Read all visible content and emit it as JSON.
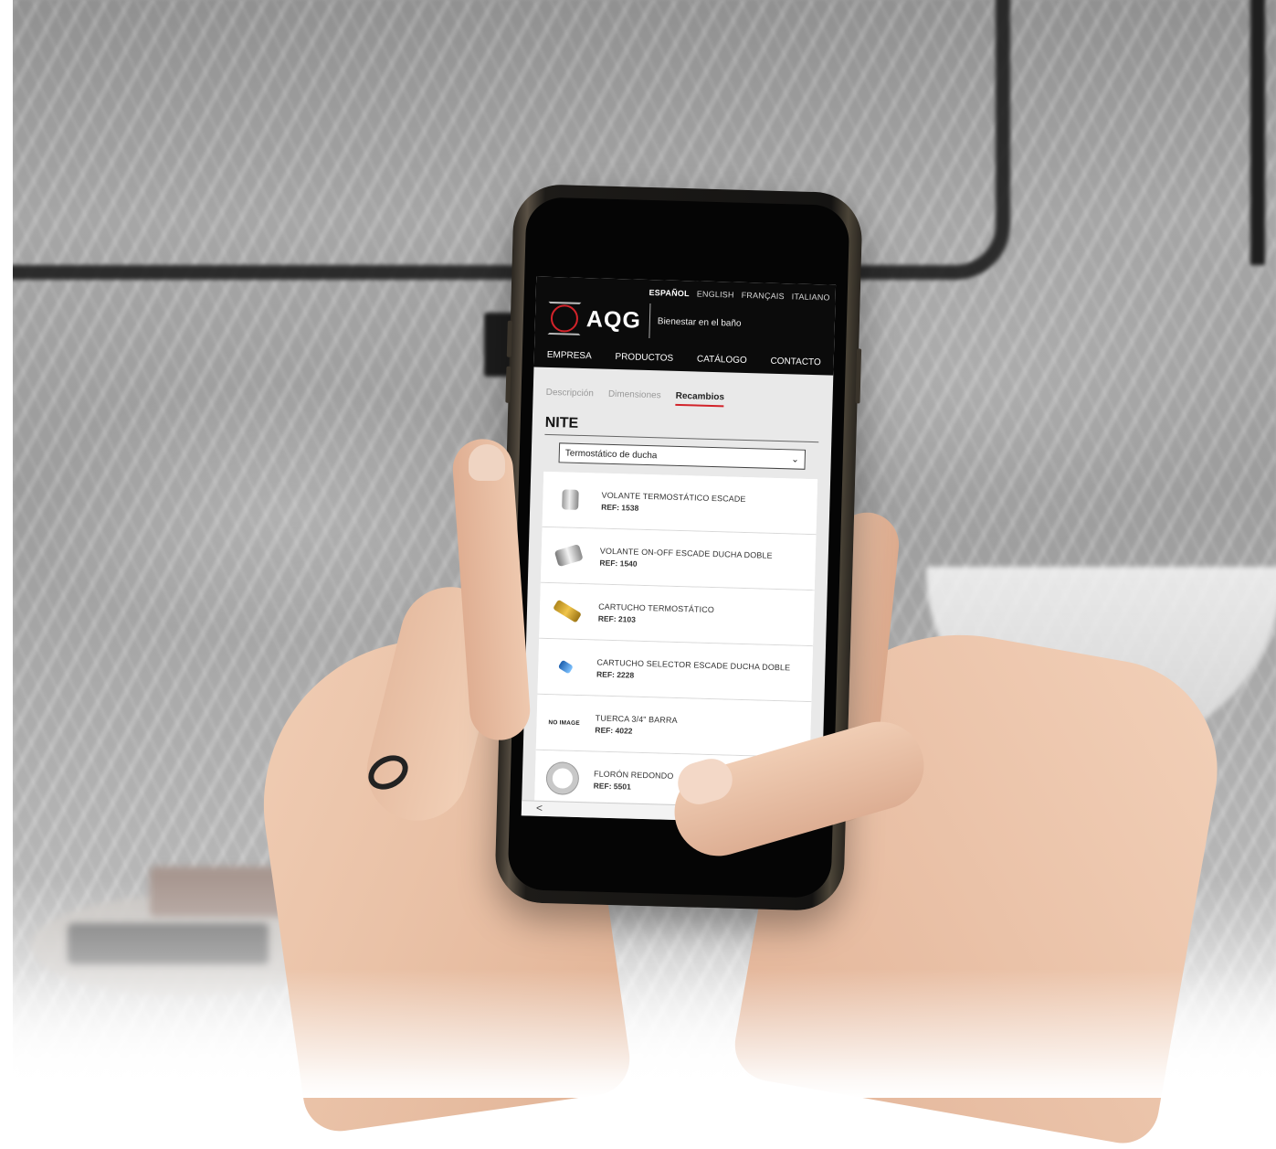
{
  "languages": [
    {
      "label": "ESPAÑOL",
      "active": true
    },
    {
      "label": "ENGLISH",
      "active": false
    },
    {
      "label": "FRANÇAIS",
      "active": false
    },
    {
      "label": "ITALIANO",
      "active": false
    }
  ],
  "brand": {
    "logo_text": "AQG",
    "tagline": "Bienestar en el baño",
    "accent_color": "#d2232a"
  },
  "nav": [
    "EMPRESA",
    "PRODUCTOS",
    "CATÁLOGO",
    "CONTACTO"
  ],
  "tabs": [
    {
      "label": "Descripción",
      "active": false
    },
    {
      "label": "Dimensiones",
      "active": false
    },
    {
      "label": "Recambios",
      "active": true
    }
  ],
  "product": {
    "title": "NITE",
    "select_value": "Termostático de ducha"
  },
  "parts": [
    {
      "name": "VOLANTE TERMOSTÁTICO ESCADE",
      "ref": "REF: 1538",
      "icon": "knob-icon"
    },
    {
      "name": "VOLANTE ON-OFF ESCADE DUCHA DOBLE",
      "ref": "REF: 1540",
      "icon": "lever-icon"
    },
    {
      "name": "CARTUCHO TERMOSTÁTICO",
      "ref": "REF: 2103",
      "icon": "cartridge-icon"
    },
    {
      "name": "CARTUCHO SELECTOR ESCADE DUCHA DOBLE",
      "ref": "REF: 2228",
      "icon": "selector-icon"
    },
    {
      "name": "TUERCA 3/4\" BARRA",
      "ref": "REF: 4022",
      "icon": "no-image",
      "icon_text": "NO IMAGE"
    },
    {
      "name": "FLORÓN REDONDO",
      "ref": "REF: 5501",
      "icon": "ring-icon"
    }
  ],
  "footer": {
    "back_arrow": "<"
  }
}
